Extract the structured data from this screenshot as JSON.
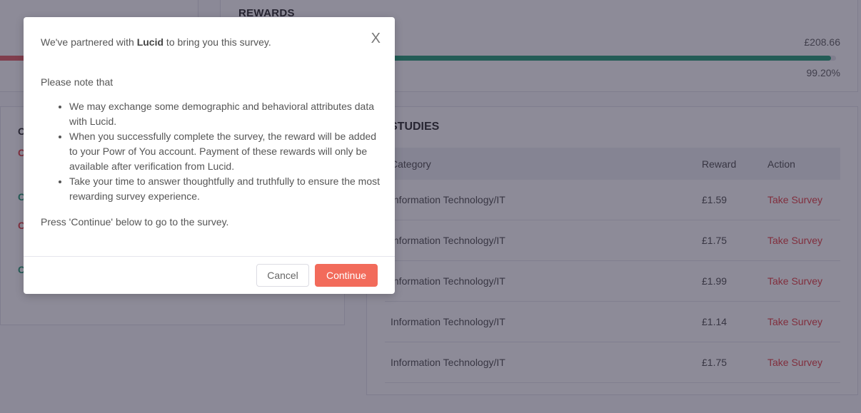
{
  "rewards": {
    "title": "REWARDS",
    "amount": "£208.66",
    "percent": "99.20%",
    "progress": 0.992
  },
  "left_card": {
    "marks": [
      "C",
      "C",
      "C",
      "C"
    ]
  },
  "studies": {
    "title": "STUDIES",
    "columns": [
      "Category",
      "Reward",
      "Action"
    ],
    "rows": [
      {
        "category": "Information Technology/IT",
        "reward": "£1.59",
        "action": "Take Survey"
      },
      {
        "category": "Information Technology/IT",
        "reward": "£1.75",
        "action": "Take Survey"
      },
      {
        "category": "Information Technology/IT",
        "reward": "£1.99",
        "action": "Take Survey"
      },
      {
        "category": "Information Technology/IT",
        "reward": "£1.14",
        "action": "Take Survey"
      },
      {
        "category": "Information Technology/IT",
        "reward": "£1.75",
        "action": "Take Survey"
      }
    ]
  },
  "modal": {
    "intro_prefix": "We've partnered with ",
    "partner": "Lucid",
    "intro_suffix": " to bring you this survey.",
    "note": "Please note that",
    "bullets": [
      "We may exchange some demographic and behavioral attributes data with Lucid.",
      "When you successfully complete the survey, the reward will be added to your Powr of You account. Payment of these rewards will only be available after verification from Lucid.",
      "Take your time to answer thoughtfully and truthfully to ensure the most rewarding survey experience."
    ],
    "press": "Press 'Continue' below to go to the survey.",
    "close_glyph": "X",
    "cancel_label": "Cancel",
    "continue_label": "Continue"
  },
  "colors": {
    "accent": "#f26b5b",
    "progress": "#2aa07a",
    "link": "#e6464a",
    "overlay": "rgba(28,24,50,0.5)"
  }
}
